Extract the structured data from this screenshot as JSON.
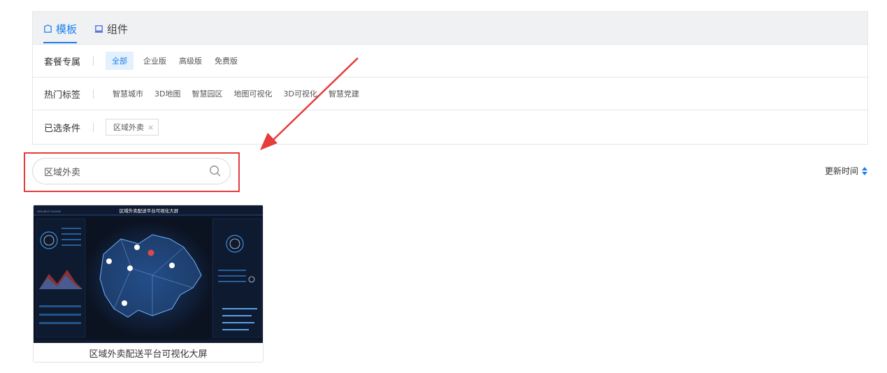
{
  "tabs": [
    {
      "label": "模板",
      "icon": "template-icon",
      "active": true
    },
    {
      "label": "组件",
      "icon": "component-icon",
      "active": false
    }
  ],
  "filters": {
    "package": {
      "label": "套餐专属",
      "options": [
        "全部",
        "企业版",
        "高级版",
        "免费版"
      ],
      "selected": "全部"
    },
    "hot_tags": {
      "label": "热门标签",
      "options": [
        "智慧城市",
        "3D地图",
        "智慧园区",
        "地图可视化",
        "3D可视化",
        "智慧党建"
      ]
    },
    "selected_conditions": {
      "label": "已选条件",
      "tags": [
        {
          "label": "区域外卖",
          "remove_icon": "close-icon",
          "remove_symbol": "×"
        }
      ]
    }
  },
  "search": {
    "value": "区域外卖",
    "icon": "search-icon"
  },
  "sort": {
    "label": "更新时间",
    "icon": "sort-icon"
  },
  "annotation": {
    "arrow_color": "#e53c3c",
    "box_color": "#e53c3c"
  },
  "results": [
    {
      "title": "区域外卖配送平台可视化大屏",
      "thumbnail": {
        "header_title": "区域外卖配送平台可视化大屏",
        "timestamp": "2022-08-07 10:03:45"
      }
    }
  ],
  "colors": {
    "accent": "#1a7ff0",
    "chip_selected_bg": "#e3f0fd",
    "tabbar_bg": "#f0f1f3",
    "annotation_red": "#e53c3c"
  }
}
